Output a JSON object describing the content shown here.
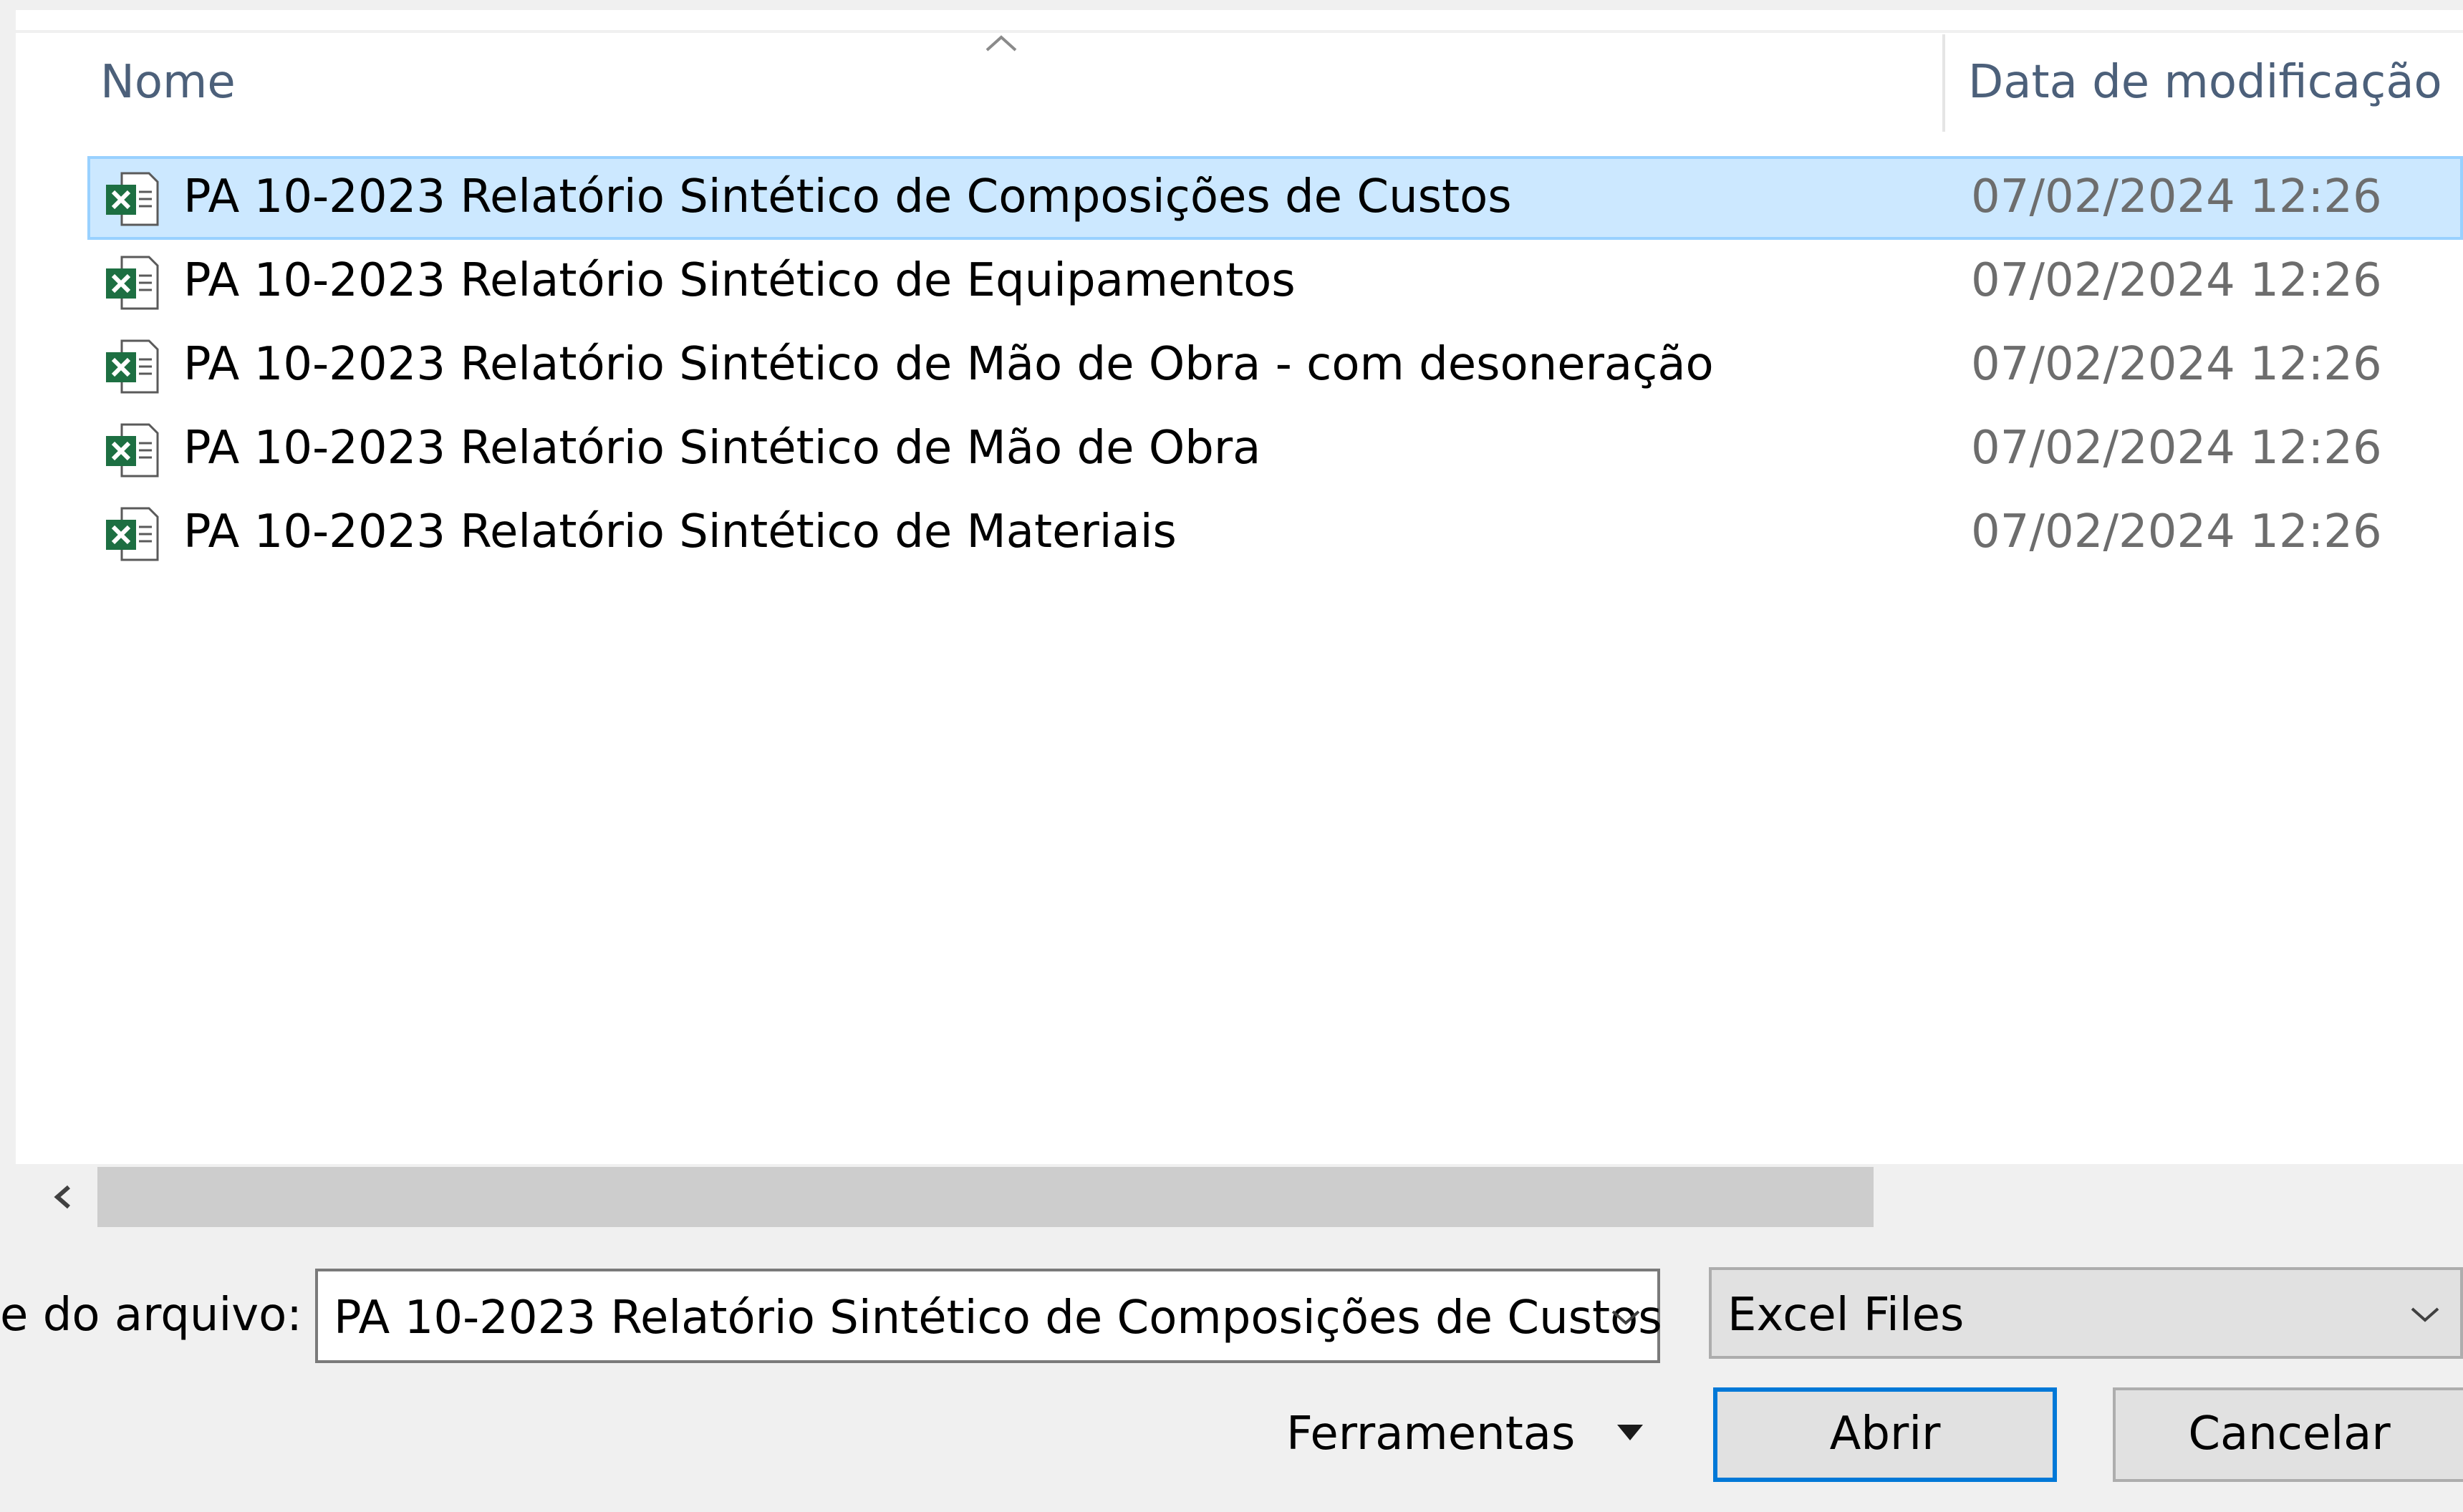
{
  "columns": {
    "name": "Nome",
    "date_modified": "Data de modificação"
  },
  "files": [
    {
      "name": "PA 10-2023 Relatório Sintético de Composições de Custos",
      "date": "07/02/2024 12:26",
      "icon": "excel-file-icon",
      "selected": true
    },
    {
      "name": "PA 10-2023 Relatório Sintético de Equipamentos",
      "date": "07/02/2024 12:26",
      "icon": "excel-file-icon",
      "selected": false
    },
    {
      "name": "PA 10-2023 Relatório Sintético de Mão de Obra - com desoneração",
      "date": "07/02/2024 12:26",
      "icon": "excel-file-icon",
      "selected": false
    },
    {
      "name": "PA 10-2023 Relatório Sintético de Mão de Obra",
      "date": "07/02/2024 12:26",
      "icon": "excel-file-icon",
      "selected": false
    },
    {
      "name": "PA 10-2023 Relatório Sintético de Materiais",
      "date": "07/02/2024 12:26",
      "icon": "excel-file-icon",
      "selected": false
    }
  ],
  "footer": {
    "filename_label": "e do arquivo:",
    "filename_value": "PA 10-2023 Relatório Sintético de Composições de Custos",
    "filetype_value": "Excel Files",
    "tools_label": "Ferramentas",
    "open_label": "Abrir",
    "cancel_label": "Cancelar"
  },
  "colors": {
    "selection_bg": "#cce8ff",
    "selection_border": "#99d1ff",
    "header_text": "#4c607a",
    "excel_green": "#1d6f42",
    "focus_blue": "#0078d7"
  }
}
